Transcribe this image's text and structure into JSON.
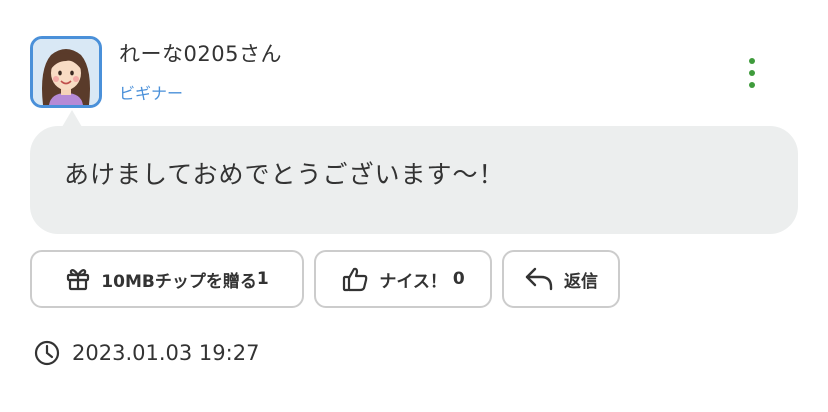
{
  "post": {
    "username": "れーな0205さん",
    "rank": "ビギナー",
    "message": "あけましておめでとうございます〜！",
    "timestamp": "2023.01.03 19:27"
  },
  "actions": {
    "gift_label": "10MBチップを贈る",
    "gift_count": "1",
    "like_label": "ナイス！",
    "like_count": "0",
    "reply_label": "返信"
  },
  "icons": {
    "menu": "kebab-menu-icon",
    "gift": "gift-icon",
    "like": "thumbs-up-icon",
    "reply": "reply-icon",
    "time": "clock-icon"
  },
  "colors": {
    "accent_blue": "#4a90d9",
    "menu_green": "#3f9b3c",
    "bubble_bg": "#eceeee",
    "button_border": "#cccccc"
  }
}
